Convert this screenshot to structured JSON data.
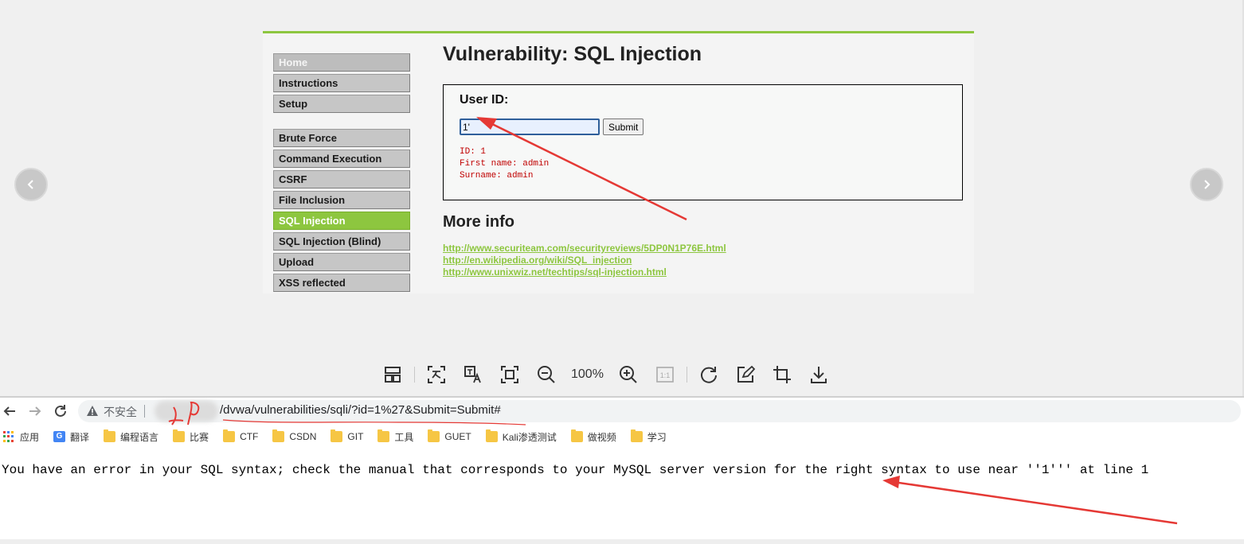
{
  "viewer": {
    "prev_icon": "chevron-left-icon",
    "next_icon": "chevron-right-icon",
    "zoom_level": "100%",
    "toolbar_icons": [
      "layout-icon",
      "ocr-text-icon",
      "translate-image-icon",
      "fit-screen-icon",
      "zoom-out-icon",
      "zoom-in-icon",
      "actual-size-icon",
      "rotate-icon",
      "edit-icon",
      "crop-icon",
      "download-icon"
    ]
  },
  "dvwa": {
    "menu": {
      "group1": [
        "Home",
        "Instructions",
        "Setup"
      ],
      "group2": [
        "Brute Force",
        "Command Execution",
        "CSRF",
        "File Inclusion",
        "SQL Injection",
        "SQL Injection (Blind)",
        "Upload",
        "XSS reflected"
      ],
      "active": "SQL Injection"
    },
    "title": "Vulnerability: SQL Injection",
    "user_id_label": "User ID:",
    "user_id_value": "1'",
    "submit_label": "Submit",
    "result": {
      "id_line": "ID: 1",
      "first_name_line": "First name: admin",
      "surname_line": "Surname: admin"
    },
    "more_info_title": "More info",
    "links": [
      "http://www.securiteam.com/securityreviews/5DP0N1P76E.html",
      "http://en.wikipedia.org/wiki/SQL_injection",
      "http://www.unixwiz.net/techtips/sql-injection.html"
    ]
  },
  "browser": {
    "insecure_label": "不安全",
    "url_path": "/dvwa/vulnerabilities/sqli/?id=1%27&Submit=Submit#",
    "bookmarks": [
      "应用",
      "翻译",
      "编程语言",
      "比赛",
      "CTF",
      "CSDN",
      "GIT",
      "工具",
      "GUET",
      "Kali渗透测试",
      "做视频",
      "学习"
    ],
    "error_message": "You have an error in your SQL syntax; check the manual that corresponds to your MySQL server version for the right syntax to use near ''1''' at line 1"
  },
  "annotations": {
    "handwriting": "IP",
    "arrow_color": "#e53935"
  }
}
